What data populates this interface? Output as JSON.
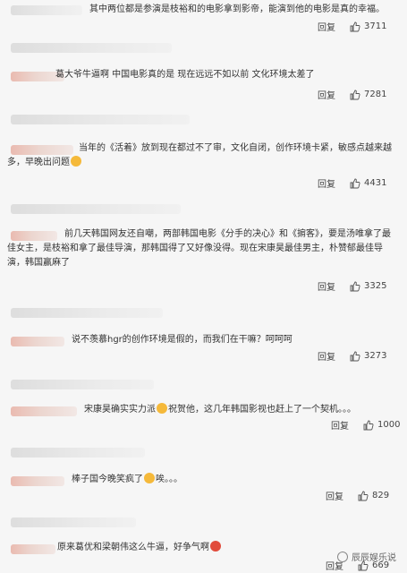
{
  "reply_label": "回复",
  "comments": [
    {
      "text": "其中两位都是参演是枝裕和的电影拿到影帝，能演到他的电影是真的幸福。",
      "likes": "3711"
    },
    {
      "text": "葛大爷牛逼啊 中国电影真的是 现在远远不如以前 文化环境太差了",
      "likes": "7281"
    },
    {
      "text": "当年的《活着》放到现在都过不了审，文化自闭，创作环境卡紧，敏感点越来越多，早晚出问题",
      "likes": "4431"
    },
    {
      "text": "前几天韩国网友还自嘲，两部韩国电影《分手的决心》和《掮客》，要是汤唯拿了最佳女主，是枝裕和拿了最佳导演，那韩国得了又好像没得。现在宋康昊最佳男主，朴赞郁最佳导演，韩国赢麻了",
      "likes": "3325"
    },
    {
      "text": "说不羡慕hgr的创作环境是假的，而我们在干嘛？呵呵呵",
      "likes": "3273"
    },
    {
      "text": "宋康昊确实实力派",
      "text2": "祝贺他，这几年韩国影视也赶上了一个契机。。。",
      "likes": "1000"
    },
    {
      "text": "棒子国今晚笑疯了",
      "text2": "唉。。。",
      "likes": "829"
    },
    {
      "text": "原来葛优和梁朝伟这么牛逼，好争气啊",
      "likes": "669"
    }
  ],
  "watermark": "辰辰娱乐说",
  "icons": {
    "like": "thumbs-up-icon",
    "emoji": "emoji-icon",
    "watermark": "wechat-logo-icon"
  }
}
